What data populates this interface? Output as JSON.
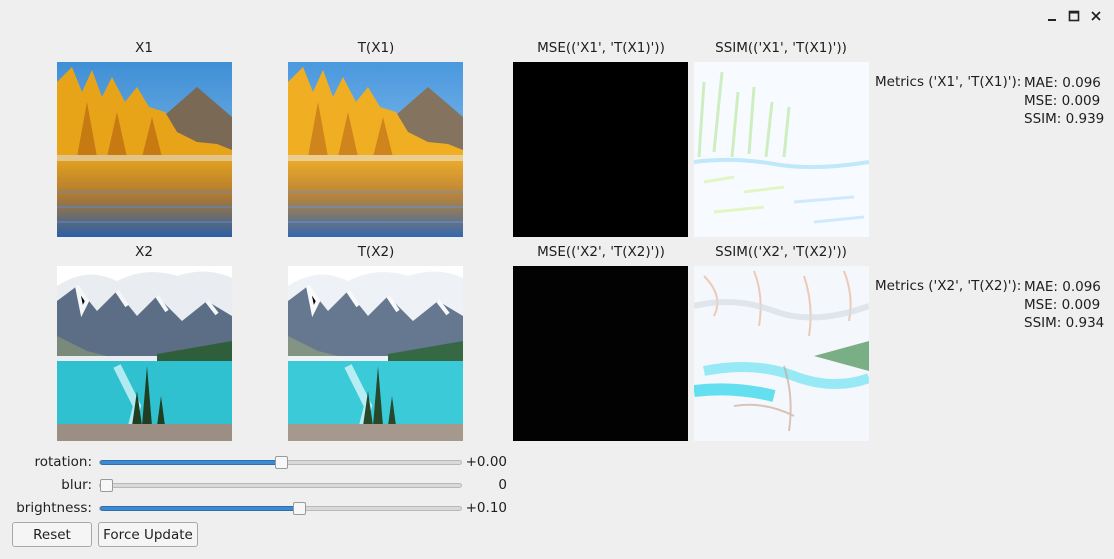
{
  "window": {
    "controls": [
      "minimize-icon",
      "maximize-icon",
      "close-icon"
    ]
  },
  "row1": {
    "x_label": "X1",
    "tx_label": "T(X1)",
    "mse_label": "MSE(('X1', 'T(X1)'))",
    "ssim_label": "SSIM(('X1', 'T(X1)'))",
    "metrics_title": "Metrics ('X1', 'T(X1)'):",
    "mae": "MAE: 0.096",
    "mse": "MSE: 0.009",
    "ssim": "SSIM: 0.939"
  },
  "row2": {
    "x_label": "X2",
    "tx_label": "T(X2)",
    "mse_label": "MSE(('X2', 'T(X2)'))",
    "ssim_label": "SSIM(('X2', 'T(X2)'))",
    "metrics_title": "Metrics ('X2', 'T(X2)'):",
    "mae": "MAE: 0.096",
    "mse": "MSE: 0.009",
    "ssim": "SSIM: 0.934"
  },
  "controls": {
    "rotation": {
      "label": "rotation:",
      "value": "+0.00",
      "level": 0.5
    },
    "blur": {
      "label": "blur:",
      "value": "0",
      "level": 0.0
    },
    "brightness": {
      "label": "brightness:",
      "value": "+0.10",
      "level": 0.55
    }
  },
  "buttons": {
    "reset": "Reset",
    "force_update": "Force Update"
  },
  "colors": {
    "accent": "#3d8ad2",
    "background": "#efefef"
  }
}
